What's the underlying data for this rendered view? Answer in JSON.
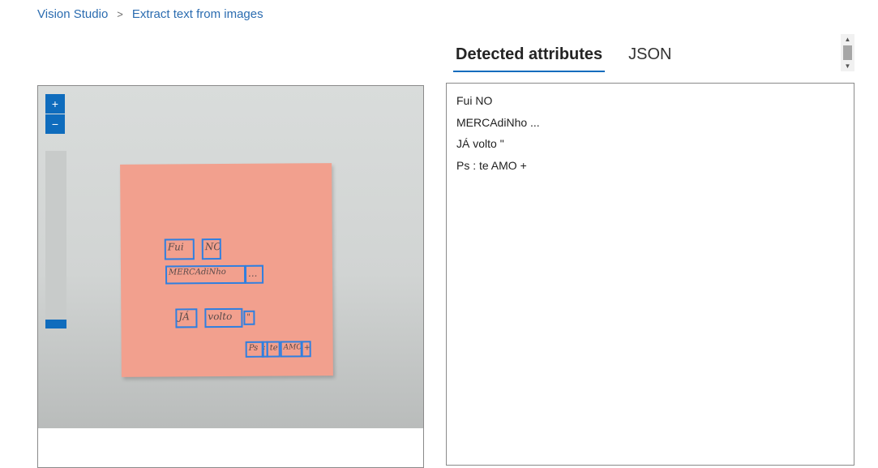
{
  "breadcrumb": {
    "root": "Vision Studio",
    "separator": ">",
    "current": "Extract text from images"
  },
  "image_viewer": {
    "zoom_in_label": "+",
    "zoom_out_label": "−",
    "detected_words": {
      "line1": [
        "Fui",
        "NO"
      ],
      "line2": [
        "MERCAdiNho",
        "..."
      ],
      "line3": [
        "JÁ",
        "volto",
        "\""
      ],
      "line4": [
        "Ps",
        ":",
        "te",
        "AMO",
        "+"
      ]
    }
  },
  "tabs": [
    {
      "label": "Detected attributes",
      "active": true
    },
    {
      "label": "JSON",
      "active": false
    }
  ],
  "results": {
    "lines": [
      "Fui NO",
      "MERCAdiNho ...",
      "JÁ volto \"",
      "Ps : te AMO +"
    ]
  },
  "colors": {
    "accent": "#0f6cbd",
    "bbox": "#2f7fe0",
    "note": "#f2a08e",
    "link": "#2b6cb0"
  }
}
